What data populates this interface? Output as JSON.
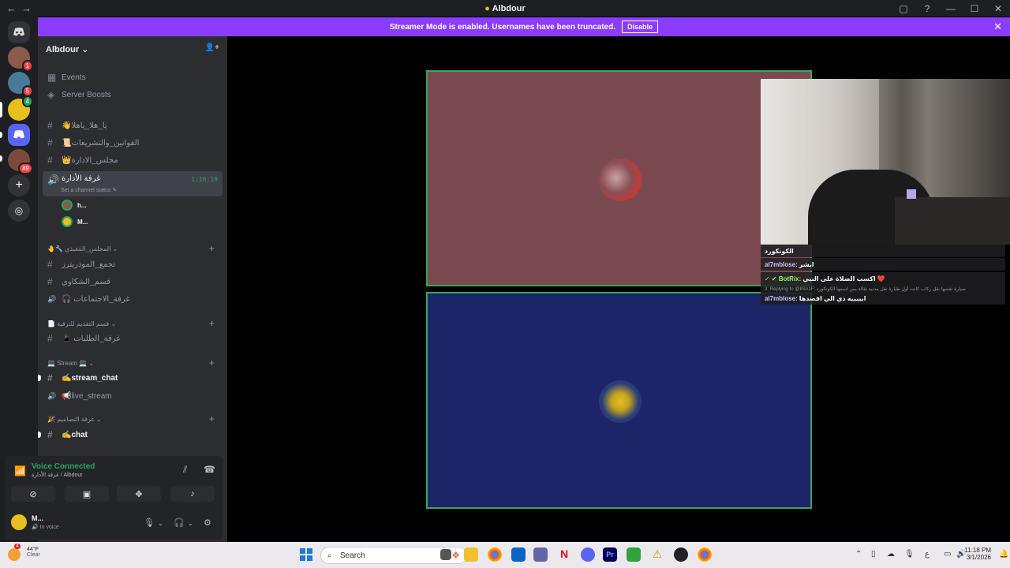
{
  "window": {
    "title": "Albdour",
    "back": "←",
    "forward": "→",
    "controls": [
      "▢",
      "?",
      "—",
      "☐",
      "✕"
    ]
  },
  "banner": {
    "text": "Streamer Mode is enabled. Usernames have been truncated.",
    "button": "Disable",
    "close": "✕"
  },
  "guilds": [
    {
      "badge": "1",
      "color": "#8a5a4a"
    },
    {
      "badge": "5",
      "color": "#4a7a9a"
    },
    {
      "badge": "4",
      "color": "#e8c020"
    },
    {
      "badge": "",
      "color": "#5865f2"
    },
    {
      "badge": "89",
      "color": "#7a4a3a"
    }
  ],
  "server": {
    "name": "Albdour",
    "chevron": "⌄",
    "invite_icon": "👤+"
  },
  "sidebar": {
    "events": "Events",
    "boosts": "Server Boosts",
    "channels_top": [
      {
        "icon": "#",
        "label": "👋يا_هلا_ياهلا"
      },
      {
        "icon": "#",
        "label": "📜القوانين_والتشريعات"
      },
      {
        "icon": "#",
        "label": "👑مجلس_الادارة"
      }
    ],
    "voice_active": {
      "label": "غرفة الأدارة",
      "timer": "1:16:19",
      "status": "Set a channel status ✎"
    },
    "voice_users": [
      "h...",
      "M..."
    ],
    "category1": {
      "label": "🤚🔧 المجلس_التنفيذي ⌄",
      "plus": "+"
    },
    "channels_cat1": [
      {
        "icon": "#",
        "label": "تجمع_المودريترز"
      },
      {
        "icon": "#",
        "label": "قسم_الشكاوي"
      },
      {
        "icon": "🔊",
        "label": "🎧 غرفة_الاجتماعات"
      }
    ],
    "category2": {
      "label": "📄 قسم التقديم للترقية ⌄",
      "plus": "+"
    },
    "channels_cat2": [
      {
        "icon": "#",
        "label": "📱 غرفة_الطلبات"
      }
    ],
    "category3": {
      "label": "💻 Stream 💻 ⌄",
      "plus": "+"
    },
    "channels_cat3": [
      {
        "icon": "#",
        "label": "✍️stream_chat"
      },
      {
        "icon": "🔊",
        "label": "📢live_stream"
      }
    ],
    "category4": {
      "label": "🎉 غرفة التصاميم ⌄",
      "plus": "+"
    },
    "channels_cat4": [
      {
        "icon": "#",
        "label": "✍️chat"
      }
    ]
  },
  "voice_panel": {
    "title": "Voice Connected",
    "subtitle": "غرفة الأدارة / Albdour",
    "user_name": "M...",
    "user_status": "🔊 In voice"
  },
  "overlay_chat": [
    {
      "name": "",
      "text": "الكونكورد"
    },
    {
      "name": "al7mblose:",
      "text": "ابشر"
    },
    {
      "name": "✓ ✔ BotRix:",
      "text": "اكسب الصلاة على النبي ❤️"
    },
    {
      "name": "",
      "text": "3: Replying to @IlSA1F: سيارة نفسها نقل ركاب كانت أول طيارة نقل مدنية نقالة يس اسمها الكونكورد"
    },
    {
      "name": "al7mblose:",
      "text": "ايييييه ذي الي اقصدها"
    }
  ],
  "taskbar": {
    "badge": "4",
    "temp": "44°F",
    "weather": "Clear",
    "search": "Search",
    "time": "11:18 PM",
    "date": "3/1/2026",
    "lang": "ع"
  }
}
